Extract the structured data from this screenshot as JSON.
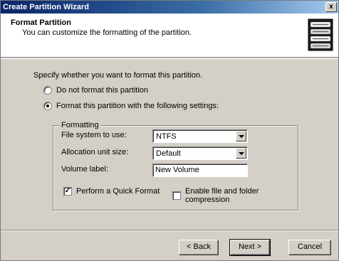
{
  "window": {
    "title": "Create Partition Wizard",
    "close_glyph": "x"
  },
  "header": {
    "title": "Format Partition",
    "subtitle": "You can customize the formatting of the partition.",
    "icon": "disk-stack-icon"
  },
  "body": {
    "prompt": "Specify whether you want to format this partition.",
    "options": [
      {
        "label": "Do not format this partition",
        "selected": false
      },
      {
        "label": "Format this partition with the following settings:",
        "selected": true
      }
    ]
  },
  "formatting": {
    "legend": "Formatting",
    "file_system_label": "File system to use:",
    "file_system_value": "NTFS",
    "allocation_label": "Allocation unit size:",
    "allocation_value": "Default",
    "volume_label": "Volume label:",
    "volume_value": "New Volume",
    "quick_format_label": "Perform a Quick Format",
    "quick_format_checked": true,
    "compression_label": "Enable file and folder compression",
    "compression_checked": false,
    "check_glyph": "✓"
  },
  "buttons": {
    "back": "< Back",
    "next": "Next >",
    "cancel": "Cancel"
  }
}
